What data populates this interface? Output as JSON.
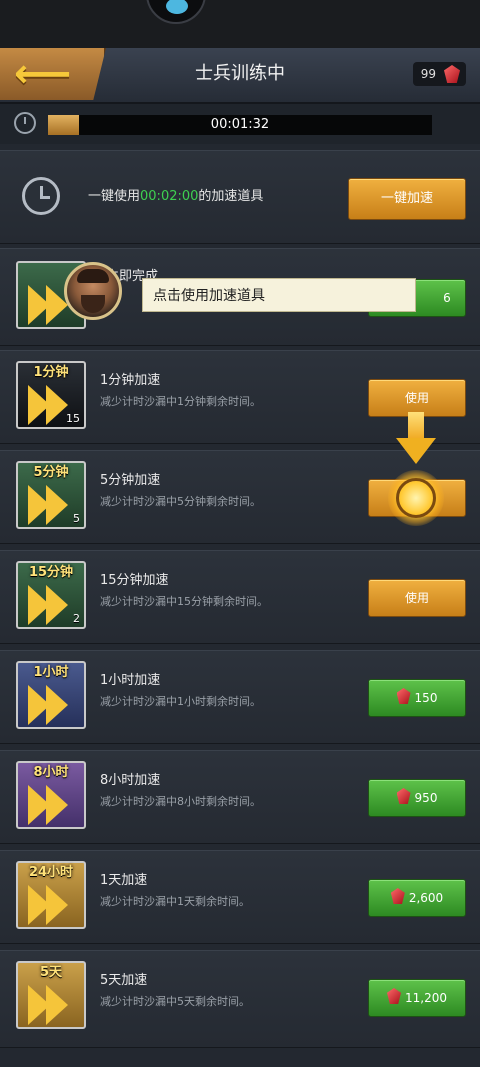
{
  "header": {
    "title": "士兵训练中",
    "gem_count": "99"
  },
  "timer": {
    "remaining": "00:01:32",
    "progress_fraction": 0.08
  },
  "one_key": {
    "text_prefix": "一键使用",
    "time": "00:02:00",
    "text_suffix": "的加速道具",
    "button_label": "一键加速"
  },
  "instant": {
    "name": "立即完成",
    "price": "6"
  },
  "tooltip": "点击使用加速道具",
  "items": [
    {
      "icon_label": "1分钟",
      "count": "15",
      "name": "1分钟加速",
      "desc": "减少计时沙漏中1分钟剩余时间。",
      "action": "使用"
    },
    {
      "icon_label": "5分钟",
      "count": "5",
      "name": "5分钟加速",
      "desc": "减少计时沙漏中5分钟剩余时间。",
      "action": "使用"
    },
    {
      "icon_label": "15分钟",
      "count": "2",
      "name": "15分钟加速",
      "desc": "减少计时沙漏中15分钟剩余时间。",
      "action": "使用"
    },
    {
      "icon_label": "1小时",
      "name": "1小时加速",
      "desc": "减少计时沙漏中1小时剩余时间。",
      "price": "150"
    },
    {
      "icon_label": "8小时",
      "name": "8小时加速",
      "desc": "减少计时沙漏中8小时剩余时间。",
      "price": "950"
    },
    {
      "icon_label": "24小时",
      "name": "1天加速",
      "desc": "减少计时沙漏中1天剩余时间。",
      "price": "2,600"
    },
    {
      "icon_label": "5天",
      "name": "5天加速",
      "desc": "减少计时沙漏中5天剩余时间。",
      "price": "11,200"
    }
  ],
  "icons": {
    "back": "back-arrow-icon",
    "gem": "red-gem-icon",
    "clock": "clock-icon",
    "speedup": "double-chevron-icon"
  },
  "colors": {
    "accent_green_text": "#3ed050",
    "button_orange": "#e2a030",
    "button_green": "#3fa62e",
    "icon_chevron": "#f5c53a"
  }
}
